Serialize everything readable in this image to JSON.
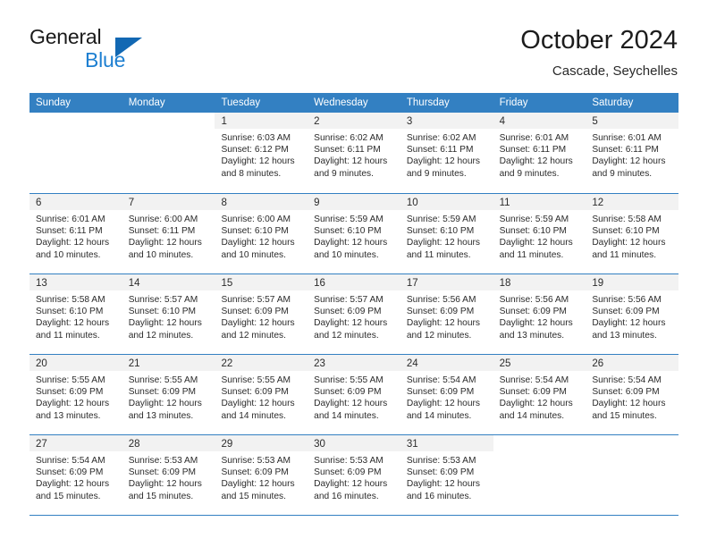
{
  "brand": {
    "word1": "General",
    "word2": "Blue",
    "triangle_color": "#1268b3",
    "blue_color": "#1d7fd1"
  },
  "header": {
    "title": "October 2024",
    "subtitle": "Cascade, Seychelles"
  },
  "theme": {
    "header_blue": "#3380c2",
    "day_band_gray": "#f2f2f2",
    "text": "#2b2b2b"
  },
  "weekday_headers": [
    "Sunday",
    "Monday",
    "Tuesday",
    "Wednesday",
    "Thursday",
    "Friday",
    "Saturday"
  ],
  "weeks": [
    [
      {
        "day": "",
        "lines": []
      },
      {
        "day": "",
        "lines": []
      },
      {
        "day": "1",
        "lines": [
          "Sunrise: 6:03 AM",
          "Sunset: 6:12 PM",
          "Daylight: 12 hours",
          "and 8 minutes."
        ]
      },
      {
        "day": "2",
        "lines": [
          "Sunrise: 6:02 AM",
          "Sunset: 6:11 PM",
          "Daylight: 12 hours",
          "and 9 minutes."
        ]
      },
      {
        "day": "3",
        "lines": [
          "Sunrise: 6:02 AM",
          "Sunset: 6:11 PM",
          "Daylight: 12 hours",
          "and 9 minutes."
        ]
      },
      {
        "day": "4",
        "lines": [
          "Sunrise: 6:01 AM",
          "Sunset: 6:11 PM",
          "Daylight: 12 hours",
          "and 9 minutes."
        ]
      },
      {
        "day": "5",
        "lines": [
          "Sunrise: 6:01 AM",
          "Sunset: 6:11 PM",
          "Daylight: 12 hours",
          "and 9 minutes."
        ]
      }
    ],
    [
      {
        "day": "6",
        "lines": [
          "Sunrise: 6:01 AM",
          "Sunset: 6:11 PM",
          "Daylight: 12 hours",
          "and 10 minutes."
        ]
      },
      {
        "day": "7",
        "lines": [
          "Sunrise: 6:00 AM",
          "Sunset: 6:11 PM",
          "Daylight: 12 hours",
          "and 10 minutes."
        ]
      },
      {
        "day": "8",
        "lines": [
          "Sunrise: 6:00 AM",
          "Sunset: 6:10 PM",
          "Daylight: 12 hours",
          "and 10 minutes."
        ]
      },
      {
        "day": "9",
        "lines": [
          "Sunrise: 5:59 AM",
          "Sunset: 6:10 PM",
          "Daylight: 12 hours",
          "and 10 minutes."
        ]
      },
      {
        "day": "10",
        "lines": [
          "Sunrise: 5:59 AM",
          "Sunset: 6:10 PM",
          "Daylight: 12 hours",
          "and 11 minutes."
        ]
      },
      {
        "day": "11",
        "lines": [
          "Sunrise: 5:59 AM",
          "Sunset: 6:10 PM",
          "Daylight: 12 hours",
          "and 11 minutes."
        ]
      },
      {
        "day": "12",
        "lines": [
          "Sunrise: 5:58 AM",
          "Sunset: 6:10 PM",
          "Daylight: 12 hours",
          "and 11 minutes."
        ]
      }
    ],
    [
      {
        "day": "13",
        "lines": [
          "Sunrise: 5:58 AM",
          "Sunset: 6:10 PM",
          "Daylight: 12 hours",
          "and 11 minutes."
        ]
      },
      {
        "day": "14",
        "lines": [
          "Sunrise: 5:57 AM",
          "Sunset: 6:10 PM",
          "Daylight: 12 hours",
          "and 12 minutes."
        ]
      },
      {
        "day": "15",
        "lines": [
          "Sunrise: 5:57 AM",
          "Sunset: 6:09 PM",
          "Daylight: 12 hours",
          "and 12 minutes."
        ]
      },
      {
        "day": "16",
        "lines": [
          "Sunrise: 5:57 AM",
          "Sunset: 6:09 PM",
          "Daylight: 12 hours",
          "and 12 minutes."
        ]
      },
      {
        "day": "17",
        "lines": [
          "Sunrise: 5:56 AM",
          "Sunset: 6:09 PM",
          "Daylight: 12 hours",
          "and 12 minutes."
        ]
      },
      {
        "day": "18",
        "lines": [
          "Sunrise: 5:56 AM",
          "Sunset: 6:09 PM",
          "Daylight: 12 hours",
          "and 13 minutes."
        ]
      },
      {
        "day": "19",
        "lines": [
          "Sunrise: 5:56 AM",
          "Sunset: 6:09 PM",
          "Daylight: 12 hours",
          "and 13 minutes."
        ]
      }
    ],
    [
      {
        "day": "20",
        "lines": [
          "Sunrise: 5:55 AM",
          "Sunset: 6:09 PM",
          "Daylight: 12 hours",
          "and 13 minutes."
        ]
      },
      {
        "day": "21",
        "lines": [
          "Sunrise: 5:55 AM",
          "Sunset: 6:09 PM",
          "Daylight: 12 hours",
          "and 13 minutes."
        ]
      },
      {
        "day": "22",
        "lines": [
          "Sunrise: 5:55 AM",
          "Sunset: 6:09 PM",
          "Daylight: 12 hours",
          "and 14 minutes."
        ]
      },
      {
        "day": "23",
        "lines": [
          "Sunrise: 5:55 AM",
          "Sunset: 6:09 PM",
          "Daylight: 12 hours",
          "and 14 minutes."
        ]
      },
      {
        "day": "24",
        "lines": [
          "Sunrise: 5:54 AM",
          "Sunset: 6:09 PM",
          "Daylight: 12 hours",
          "and 14 minutes."
        ]
      },
      {
        "day": "25",
        "lines": [
          "Sunrise: 5:54 AM",
          "Sunset: 6:09 PM",
          "Daylight: 12 hours",
          "and 14 minutes."
        ]
      },
      {
        "day": "26",
        "lines": [
          "Sunrise: 5:54 AM",
          "Sunset: 6:09 PM",
          "Daylight: 12 hours",
          "and 15 minutes."
        ]
      }
    ],
    [
      {
        "day": "27",
        "lines": [
          "Sunrise: 5:54 AM",
          "Sunset: 6:09 PM",
          "Daylight: 12 hours",
          "and 15 minutes."
        ]
      },
      {
        "day": "28",
        "lines": [
          "Sunrise: 5:53 AM",
          "Sunset: 6:09 PM",
          "Daylight: 12 hours",
          "and 15 minutes."
        ]
      },
      {
        "day": "29",
        "lines": [
          "Sunrise: 5:53 AM",
          "Sunset: 6:09 PM",
          "Daylight: 12 hours",
          "and 15 minutes."
        ]
      },
      {
        "day": "30",
        "lines": [
          "Sunrise: 5:53 AM",
          "Sunset: 6:09 PM",
          "Daylight: 12 hours",
          "and 16 minutes."
        ]
      },
      {
        "day": "31",
        "lines": [
          "Sunrise: 5:53 AM",
          "Sunset: 6:09 PM",
          "Daylight: 12 hours",
          "and 16 minutes."
        ]
      },
      {
        "day": "",
        "lines": []
      },
      {
        "day": "",
        "lines": []
      }
    ]
  ]
}
